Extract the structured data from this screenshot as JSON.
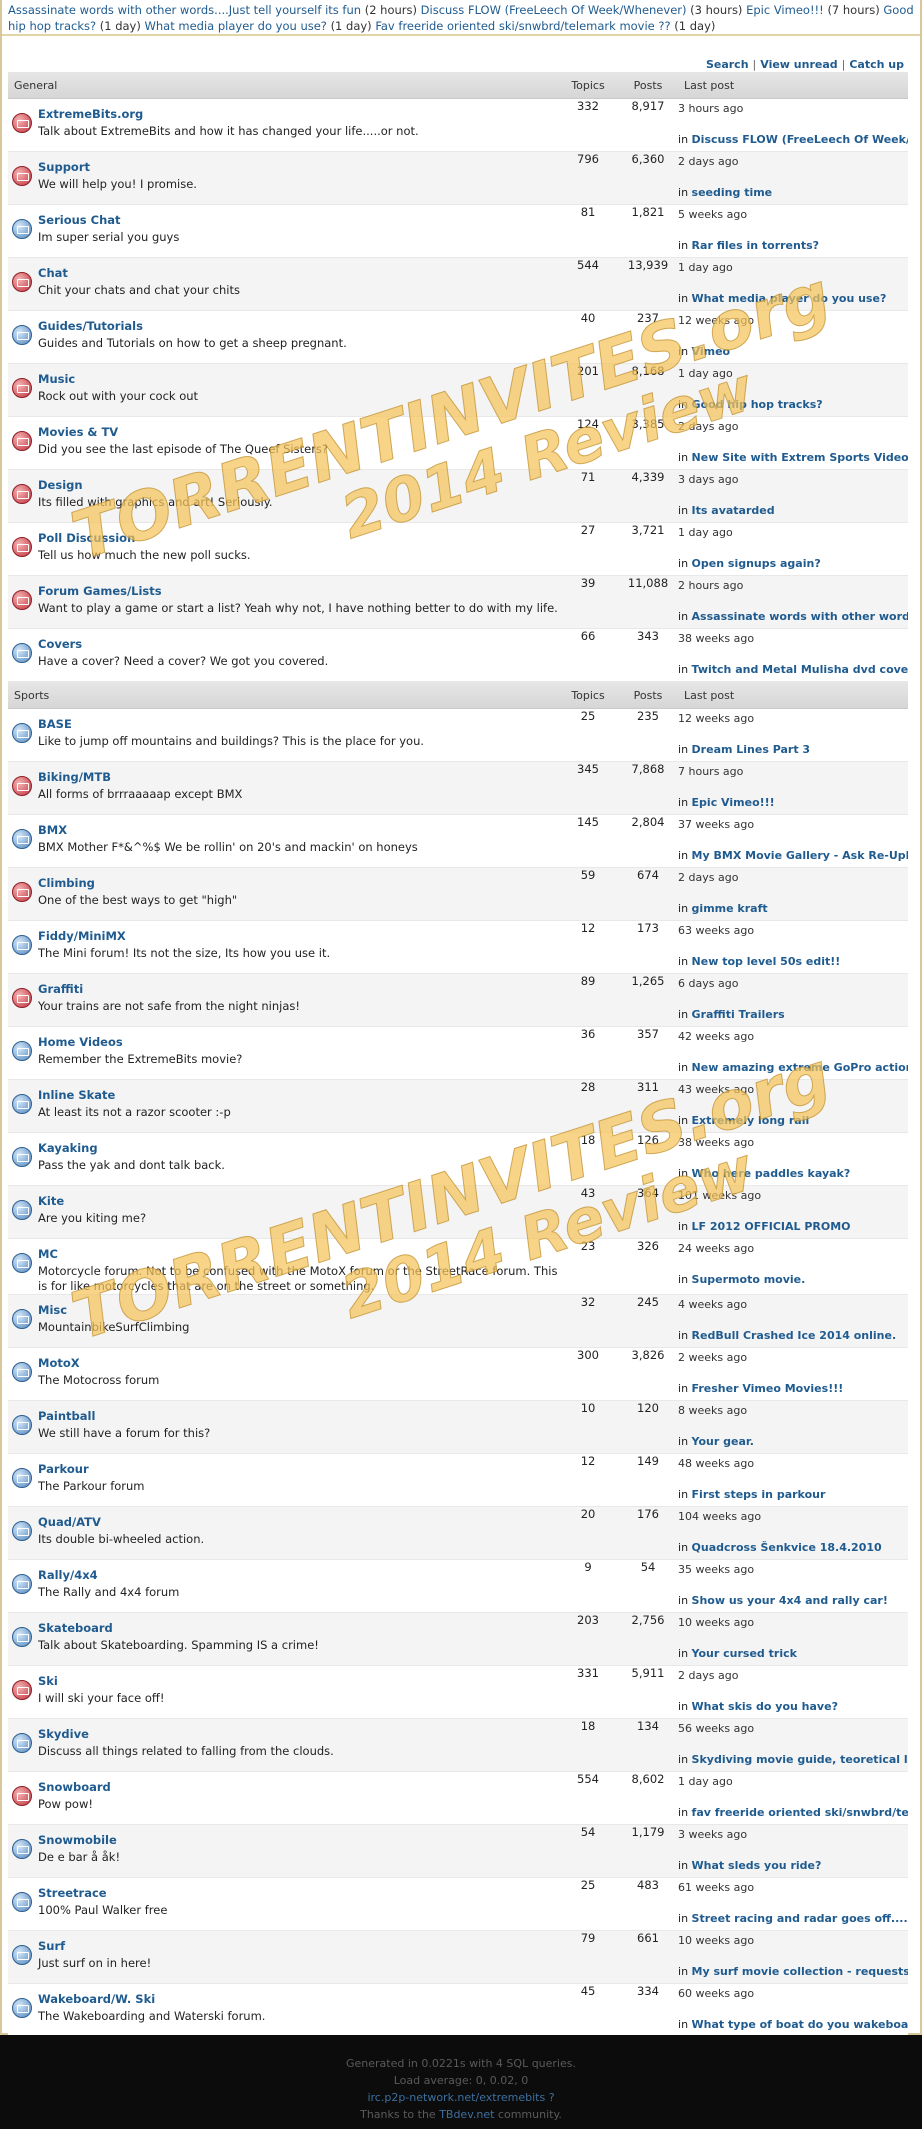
{
  "ticker": [
    {
      "title": "Assassinate words with other words....Just tell yourself its fun",
      "time": "(2 hours)"
    },
    {
      "title": "Discuss FLOW (FreeLeech Of Week/Whenever)",
      "time": "(3 hours)"
    },
    {
      "title": "Epic Vimeo!!!",
      "time": "(7 hours)"
    },
    {
      "title": "Good hip hop tracks?",
      "time": "(1 day)"
    },
    {
      "title": "What media player do you use?",
      "time": "(1 day)"
    },
    {
      "title": "Fav freeride oriented ski/snwbrd/telemark movie ??",
      "time": "(1 day)"
    }
  ],
  "toplinks": {
    "search": "Search",
    "view_unread": "View unread",
    "catch_up": "Catch up",
    "sep": "|"
  },
  "sections": [
    {
      "name": "General",
      "col_topics": "Topics",
      "col_posts": "Posts",
      "col_last": "Last post",
      "forums": [
        {
          "name": "ExtremeBits.org",
          "desc": "Talk about ExtremeBits and how it has changed your life.....or not.",
          "topics": "332",
          "posts": "8,917",
          "last_time": "3 hours ago",
          "last_title": "Discuss FLOW (FreeLeech Of Week/Whenever)",
          "icon": "new"
        },
        {
          "name": "Support",
          "desc": "We will help you! I promise.",
          "topics": "796",
          "posts": "6,360",
          "last_time": "2 days ago",
          "last_title": "seeding time",
          "icon": "new"
        },
        {
          "name": "Serious Chat",
          "desc": "Im super serial you guys",
          "topics": "81",
          "posts": "1,821",
          "last_time": "5 weeks ago",
          "last_title": "Rar files in torrents?",
          "icon": "old"
        },
        {
          "name": "Chat",
          "desc": "Chit your chats and chat your chits",
          "topics": "544",
          "posts": "13,939",
          "last_time": "1 day ago",
          "last_title": "What media player do you use?",
          "icon": "new"
        },
        {
          "name": "Guides/Tutorials",
          "desc": "Guides and Tutorials on how to get a sheep pregnant.",
          "topics": "40",
          "posts": "237",
          "last_time": "12 weeks ago",
          "last_title": "Vimeo",
          "icon": "old"
        },
        {
          "name": "Music",
          "desc": "Rock out with your cock out",
          "topics": "201",
          "posts": "8,168",
          "last_time": "1 day ago",
          "last_title": "Good hip hop tracks?",
          "icon": "new"
        },
        {
          "name": "Movies & TV",
          "desc": "Did you see the last episode of The Queef Sisters?",
          "topics": "124",
          "posts": "3,385",
          "last_time": "2 days ago",
          "last_title": "New Site with Extrem Sports Videos",
          "icon": "new"
        },
        {
          "name": "Design",
          "desc": "Its filled with graphics and art! Seriously.",
          "topics": "71",
          "posts": "4,339",
          "last_time": "3 days ago",
          "last_title": "Its avatarded",
          "icon": "new"
        },
        {
          "name": "Poll Discussion",
          "desc": "Tell us how much the new poll sucks.",
          "topics": "27",
          "posts": "3,721",
          "last_time": "1 day ago",
          "last_title": "Open signups again?",
          "icon": "new"
        },
        {
          "name": "Forum Games/Lists",
          "desc": "Want to play a game or start a list? Yeah why not, I have nothing better to do with my life.",
          "topics": "39",
          "posts": "11,088",
          "last_time": "2 hours ago",
          "last_title": "Assassinate words with other words....Jus..",
          "icon": "new"
        },
        {
          "name": "Covers",
          "desc": "Have a cover? Need a cover? We got you covered.",
          "topics": "66",
          "posts": "343",
          "last_time": "38 weeks ago",
          "last_title": "Twitch and Metal Mulisha dvd covers.",
          "icon": "old"
        }
      ]
    },
    {
      "name": "Sports",
      "col_topics": "Topics",
      "col_posts": "Posts",
      "col_last": "Last post",
      "forums": [
        {
          "name": "BASE",
          "desc": "Like to jump off mountains and buildings? This is the place for you.",
          "topics": "25",
          "posts": "235",
          "last_time": "12 weeks ago",
          "last_title": "Dream Lines Part 3",
          "icon": "old"
        },
        {
          "name": "Biking/MTB",
          "desc": "All forms of brrraaaaap except BMX",
          "topics": "345",
          "posts": "7,868",
          "last_time": "7 hours ago",
          "last_title": "Epic Vimeo!!!",
          "icon": "new"
        },
        {
          "name": "BMX",
          "desc": "BMX Mother F*&^%$ We be rollin' on 20's and mackin' on honeys",
          "topics": "145",
          "posts": "2,804",
          "last_time": "37 weeks ago",
          "last_title": "My BMX Movie Gallery - Ask Re-Upload's",
          "icon": "old"
        },
        {
          "name": "Climbing",
          "desc": "One of the best ways to get \"high\"",
          "topics": "59",
          "posts": "674",
          "last_time": "2 days ago",
          "last_title": "gimme kraft",
          "icon": "new"
        },
        {
          "name": "Fiddy/MiniMX",
          "desc": "The Mini forum! Its not the size, Its how you use it.",
          "topics": "12",
          "posts": "173",
          "last_time": "63 weeks ago",
          "last_title": "New top level 50s edit!!",
          "icon": "old"
        },
        {
          "name": "Graffiti",
          "desc": "Your trains are not safe from the night ninjas!",
          "topics": "89",
          "posts": "1,265",
          "last_time": "6 days ago",
          "last_title": "Graffiti Trailers",
          "icon": "new"
        },
        {
          "name": "Home Videos",
          "desc": "Remember the ExtremeBits movie?",
          "topics": "36",
          "posts": "357",
          "last_time": "42 weeks ago",
          "last_title": "New amazing extreme GoPro action video + ..",
          "icon": "old"
        },
        {
          "name": "Inline Skate",
          "desc": "At least its not a razor scooter :-p",
          "topics": "28",
          "posts": "311",
          "last_time": "43 weeks ago",
          "last_title": "Extremely long rail",
          "icon": "old"
        },
        {
          "name": "Kayaking",
          "desc": "Pass the yak and dont talk back.",
          "topics": "18",
          "posts": "126",
          "last_time": "38 weeks ago",
          "last_title": "Who here paddles kayak?",
          "icon": "old"
        },
        {
          "name": "Kite",
          "desc": "Are you kiting me?",
          "topics": "43",
          "posts": "364",
          "last_time": "101 weeks ago",
          "last_title": "LF 2012 OFFICIAL PROMO",
          "icon": "old"
        },
        {
          "name": "MC",
          "desc": "Motorcycle forum. Not to be confused with the MotoX forum or the StreetRace forum. This is for like motorcycles that are on the street or something.",
          "topics": "23",
          "posts": "326",
          "last_time": "24 weeks ago",
          "last_title": "Supermoto movie.",
          "icon": "old"
        },
        {
          "name": "Misc",
          "desc": "MountainbikeSurfClimbing",
          "topics": "32",
          "posts": "245",
          "last_time": "4 weeks ago",
          "last_title": "RedBull Crashed Ice 2014 online.",
          "icon": "old"
        },
        {
          "name": "MotoX",
          "desc": "The Motocross forum",
          "topics": "300",
          "posts": "3,826",
          "last_time": "2 weeks ago",
          "last_title": "Fresher Vimeo Movies!!!",
          "icon": "old"
        },
        {
          "name": "Paintball",
          "desc": "We still have a forum for this?",
          "topics": "10",
          "posts": "120",
          "last_time": "8 weeks ago",
          "last_title": "Your gear.",
          "icon": "old"
        },
        {
          "name": "Parkour",
          "desc": "The Parkour forum",
          "topics": "12",
          "posts": "149",
          "last_time": "48 weeks ago",
          "last_title": "First steps in parkour",
          "icon": "old"
        },
        {
          "name": "Quad/ATV",
          "desc": "Its double bi-wheeled action.",
          "topics": "20",
          "posts": "176",
          "last_time": "104 weeks ago",
          "last_title": "Quadcross Šenkvice 18.4.2010",
          "icon": "old"
        },
        {
          "name": "Rally/4x4",
          "desc": "The Rally and 4x4 forum",
          "topics": "9",
          "posts": "54",
          "last_time": "35 weeks ago",
          "last_title": "Show us your 4x4 and rally car!",
          "icon": "old"
        },
        {
          "name": "Skateboard",
          "desc": "Talk about Skateboarding. Spamming IS a crime!",
          "topics": "203",
          "posts": "2,756",
          "last_time": "10 weeks ago",
          "last_title": "Your cursed trick",
          "icon": "old"
        },
        {
          "name": "Ski",
          "desc": "I will ski your face off!",
          "topics": "331",
          "posts": "5,911",
          "last_time": "2 days ago",
          "last_title": "What skis do you have?",
          "icon": "new"
        },
        {
          "name": "Skydive",
          "desc": "Discuss all things related to falling from the clouds.",
          "topics": "18",
          "posts": "134",
          "last_time": "56 weeks ago",
          "last_title": "Skydiving movie guide, teoretical lessons?",
          "icon": "old"
        },
        {
          "name": "Snowboard",
          "desc": "Pow pow!",
          "topics": "554",
          "posts": "8,602",
          "last_time": "1 day ago",
          "last_title": "fav freeride oriented ski/snwbrd/telemark..",
          "icon": "new"
        },
        {
          "name": "Snowmobile",
          "desc": "De e bar å åk!",
          "topics": "54",
          "posts": "1,179",
          "last_time": "3 weeks ago",
          "last_title": "What sleds you ride?",
          "icon": "old"
        },
        {
          "name": "Streetrace",
          "desc": "100% Paul Walker free",
          "topics": "25",
          "posts": "483",
          "last_time": "61 weeks ago",
          "last_title": "Street racing and radar goes off.....",
          "icon": "old"
        },
        {
          "name": "Surf",
          "desc": "Just surf on in here!",
          "topics": "79",
          "posts": "661",
          "last_time": "10 weeks ago",
          "last_title": "My surf movie collection - requests?",
          "icon": "old"
        },
        {
          "name": "Wakeboard/W. Ski",
          "desc": "The Wakeboarding and Waterski forum.",
          "topics": "45",
          "posts": "334",
          "last_time": "60 weeks ago",
          "last_title": "What type of boat do you wakeboard behind?",
          "icon": "old"
        }
      ]
    }
  ],
  "in_label": "in",
  "watermark": {
    "line1": "TORRENTINVITES.org",
    "line2": "2014 Review"
  },
  "footer": {
    "generated": "Generated in 0.0221s with 4 SQL queries.",
    "load": "Load average: 0, 0.02, 0",
    "irc": "irc.p2p-network.net/extremebits ?",
    "thanks_pre": "Thanks to the ",
    "thanks_link": "TBdev.net",
    "thanks_post": " community."
  },
  "colors": {
    "link": "#1f5b8f",
    "new_icon": "#c0303a",
    "old_icon": "#4f86c0",
    "frame": "#d8c79a",
    "footer_bg": "#0c0c0c"
  }
}
